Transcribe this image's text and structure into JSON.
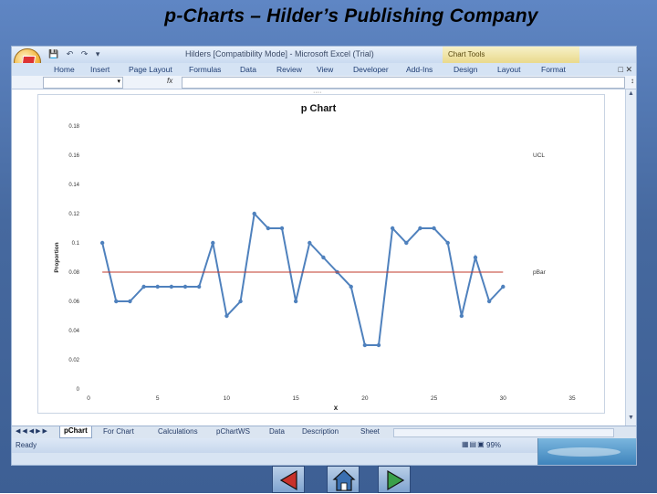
{
  "slide": {
    "title": "p-Charts  –  Hilder’s Publishing Company"
  },
  "excel": {
    "window_title": "Hilders  [Compatibility Mode] - Microsoft Excel (Trial)",
    "quick_access": [
      "save",
      "undo",
      "redo",
      "customize"
    ],
    "chart_tools_label": "Chart Tools",
    "ribbon_tabs": [
      "Home",
      "Insert",
      "Page Layout",
      "Formulas",
      "Data",
      "Review",
      "View",
      "Developer",
      "Add-Ins",
      "Design",
      "Layout",
      "Format"
    ],
    "formula_bar": {
      "fx_label": "fx",
      "name_box": "",
      "value": ""
    },
    "sheet_tabs": [
      "pChart",
      "For Chart",
      "Calculations",
      "pChartWS",
      "Data",
      "Description",
      "Sheet"
    ],
    "active_sheet": "pChart",
    "status": "Ready",
    "zoom": "99%"
  },
  "chart_data": {
    "type": "line",
    "title": "p Chart",
    "xlabel": "x",
    "ylabel": "Proportion",
    "xlim": [
      0,
      35
    ],
    "ylim": [
      0,
      0.18
    ],
    "x_ticks": [
      0,
      5,
      10,
      15,
      20,
      25,
      30,
      35
    ],
    "y_ticks": [
      "0",
      "0.02",
      "0.04",
      "0.06",
      "0.08",
      "0.1",
      "0.12",
      "0.14",
      "0.16",
      "0.18"
    ],
    "grid": false,
    "series": [
      {
        "name": "",
        "color": "#4f81bd",
        "x": [
          1,
          2,
          3,
          4,
          5,
          6,
          7,
          8,
          9,
          10,
          11,
          12,
          13,
          14,
          15,
          16,
          17,
          18,
          19,
          20,
          21,
          22,
          23,
          24,
          25,
          26,
          27,
          28,
          29,
          30
        ],
        "y": [
          0.1,
          0.06,
          0.06,
          0.07,
          0.07,
          0.07,
          0.07,
          0.07,
          0.1,
          0.05,
          0.06,
          0.12,
          0.11,
          0.11,
          0.06,
          0.1,
          0.09,
          0.08,
          0.07,
          0.03,
          0.03,
          0.11,
          0.1,
          0.11,
          0.11,
          0.1,
          0.05,
          0.09,
          0.06,
          0.07
        ]
      },
      {
        "name": "pBar",
        "color": "#c0392b",
        "x": [
          1,
          30
        ],
        "y": [
          0.08,
          0.08
        ]
      }
    ],
    "annotations": [
      {
        "text": "UCL",
        "y": 0.16
      },
      {
        "text": "pBar",
        "y": 0.08
      }
    ]
  },
  "nav_buttons": [
    {
      "icon": "previous-arrow-icon",
      "color": "#c8312a"
    },
    {
      "icon": "home-icon",
      "color": "#3a6fb0"
    },
    {
      "icon": "next-arrow-icon",
      "color": "#3aa04a"
    }
  ]
}
